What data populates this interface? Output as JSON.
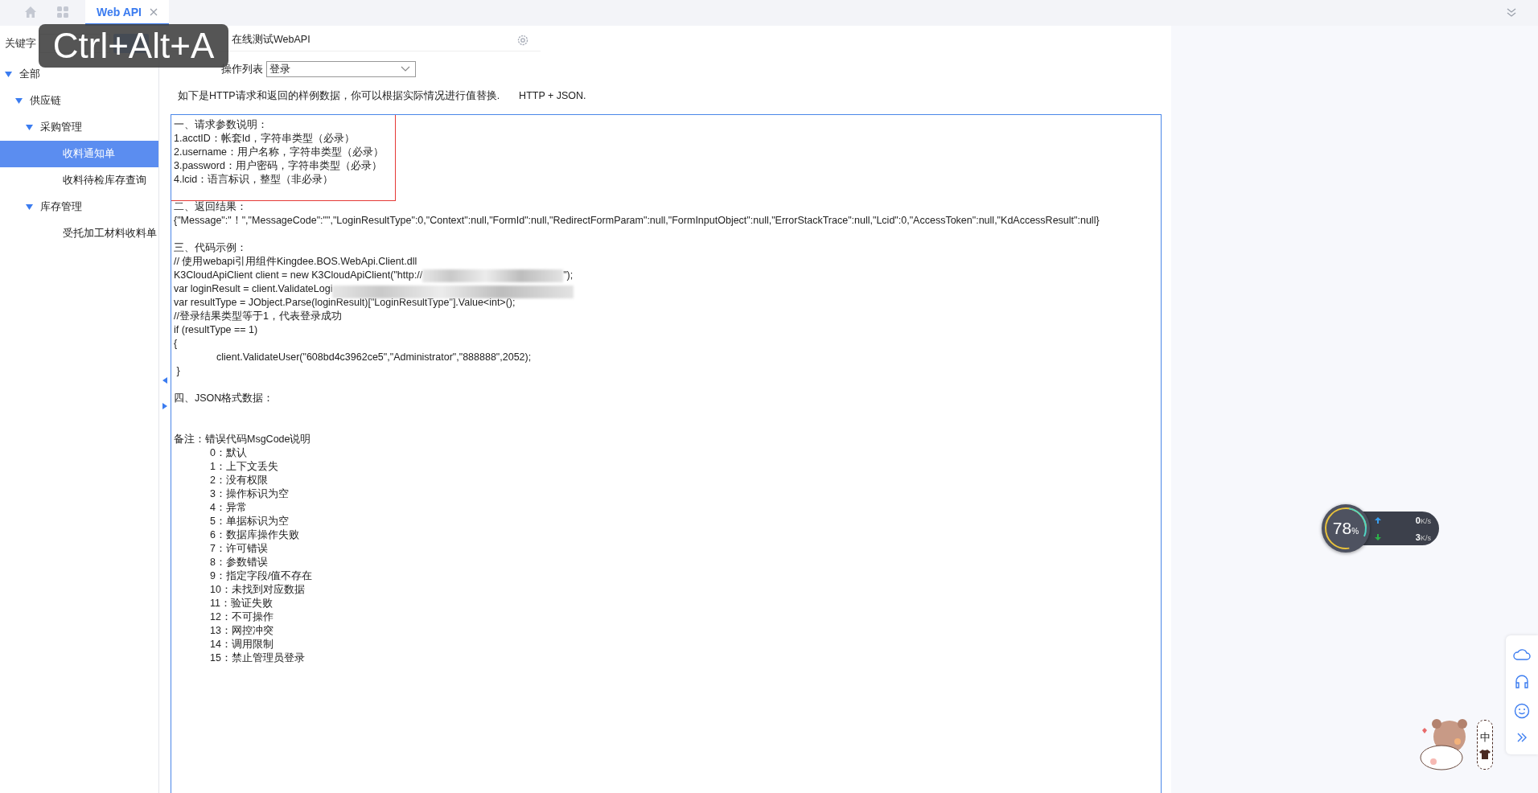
{
  "tabs": [
    {
      "kind": "home",
      "selected": false
    },
    {
      "kind": "apps",
      "selected": false
    },
    {
      "kind": "text",
      "label": "Web API",
      "selected": true
    }
  ],
  "sidebar": {
    "keyword_label": "关键字",
    "tree": [
      {
        "label": "全部",
        "expanded": true,
        "selected": false,
        "children": [
          {
            "label": "供应链",
            "expanded": true,
            "selected": false,
            "children": [
              {
                "label": "采购管理",
                "expanded": true,
                "selected": false,
                "children": [
                  {
                    "label": "收料通知单",
                    "selected": true
                  },
                  {
                    "label": "收料待检库存查询",
                    "selected": false
                  }
                ]
              },
              {
                "label": "库存管理",
                "expanded": true,
                "selected": false,
                "children": [
                  {
                    "label": "受托加工材料收料单",
                    "selected": false
                  }
                ]
              }
            ]
          }
        ]
      }
    ]
  },
  "panel_title": "在线测试WebAPI",
  "operation": {
    "label": "操作列表",
    "value": "登录"
  },
  "description": [
    "如下是HTTP请求和返回的样例数据，你可以根据实际情况进行值替换.",
    "HTTP + JSON."
  ],
  "sections": [
    {
      "kind": "highlighted",
      "heading": "一、请求参数说明：",
      "lines": [
        {
          "kind": "text",
          "text": "1.acctID：帐套Id，字符串类型（必录）"
        },
        {
          "kind": "text",
          "text": "2.username：用户名称，字符串类型（必录）"
        },
        {
          "kind": "text",
          "text": "3.password：用户密码，字符串类型（必录）"
        },
        {
          "kind": "text",
          "text": "4.lcid：语言标识，整型（非必录）"
        }
      ]
    },
    {
      "kind": "plain",
      "heading": "二、返回结果：",
      "lines": [
        {
          "kind": "text",
          "text": "{\"Message\":\"！\",\"MessageCode\":\"\",\"LoginResultType\":0,\"Context\":null,\"FormId\":null,\"RedirectFormParam\":null,\"FormInputObject\":null,\"ErrorStackTrace\":null,\"Lcid\":0,\"AccessToken\":null,\"KdAccessResult\":null}"
        }
      ]
    },
    {
      "kind": "plain",
      "heading": "三、代码示例：",
      "lines": [
        {
          "kind": "text",
          "text": "// 使用webapi引用组件Kingdee.BOS.WebApi.Client.dll"
        },
        {
          "kind": "redacted",
          "text": "K3CloudApiClient client = new K3CloudApiClient(\"http://",
          "tail": "\");"
        },
        {
          "kind": "redacted-end",
          "text": "var loginResult = client.ValidateLogi"
        },
        {
          "kind": "text",
          "text": "var resultType = JObject.Parse(loginResult)[\"LoginResultType\"].Value<int>();"
        },
        {
          "kind": "text",
          "text": "//登录结果类型等于1，代表登录成功"
        },
        {
          "kind": "text",
          "text": "if (resultType == 1)"
        },
        {
          "kind": "text",
          "text": "{"
        },
        {
          "kind": "indent",
          "text": "client.ValidateUser(\"608bd4c3962ce5\",\"Administrator\",\"888888\",2052);"
        },
        {
          "kind": "text",
          "text": " }"
        }
      ]
    },
    {
      "kind": "spaced",
      "heading": "四、JSON格式数据："
    },
    {
      "kind": "notes",
      "heading": "备注：错误代码MsgCode说明",
      "lines": [
        {
          "kind": "indent",
          "text": "0：默认"
        },
        {
          "kind": "indent",
          "text": "1：上下文丢失"
        },
        {
          "kind": "indent",
          "text": "2：没有权限"
        },
        {
          "kind": "indent",
          "text": "3：操作标识为空"
        },
        {
          "kind": "indent",
          "text": "4：异常"
        },
        {
          "kind": "indent",
          "text": "5：单据标识为空"
        },
        {
          "kind": "indent",
          "text": "6：数据库操作失败"
        },
        {
          "kind": "indent",
          "text": "7：许可错误"
        },
        {
          "kind": "indent",
          "text": "8：参数错误"
        },
        {
          "kind": "indent",
          "text": "9：指定字段/值不存在"
        },
        {
          "kind": "indent",
          "text": "10：未找到对应数据"
        },
        {
          "kind": "indent",
          "text": "11：验证失败"
        },
        {
          "kind": "indent",
          "text": "12：不可操作"
        },
        {
          "kind": "indent",
          "text": "13：网控冲突"
        },
        {
          "kind": "indent",
          "text": "14：调用限制"
        },
        {
          "kind": "indent",
          "text": "15：禁止管理员登录"
        }
      ]
    }
  ],
  "net_widget": {
    "percent": "78",
    "percent_unit": "%",
    "up": "0",
    "up_unit": "K/s",
    "down": "3",
    "down_unit": "K/s"
  },
  "ime": "中",
  "overlay": "Ctrl+Alt+A"
}
